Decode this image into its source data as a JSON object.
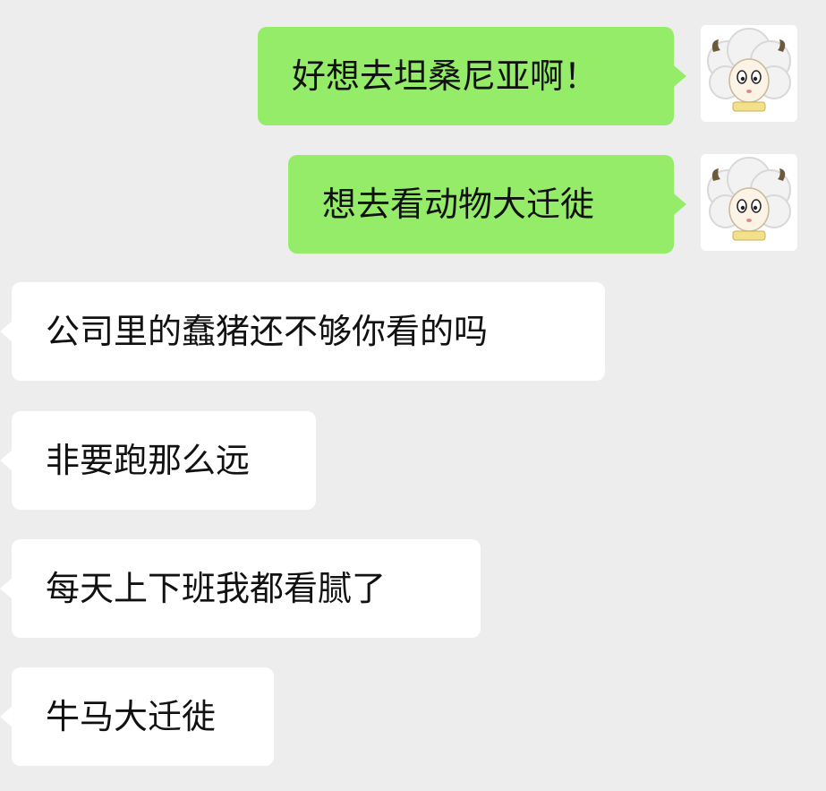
{
  "conversation": {
    "messages": [
      {
        "sender": "me",
        "text": "好想去坦桑尼亚啊！"
      },
      {
        "sender": "me",
        "text": "想去看动物大迁徙"
      },
      {
        "sender": "other",
        "text": "公司里的蠢猪还不够你看的吗"
      },
      {
        "sender": "other",
        "text": "非要跑那么远"
      },
      {
        "sender": "other",
        "text": "每天上下班我都看腻了"
      },
      {
        "sender": "other",
        "text": "牛马大迁徙"
      }
    ]
  },
  "colors": {
    "background": "#ededed",
    "sent_bubble": "#95ec69",
    "received_bubble": "#ffffff",
    "text": "#111111"
  },
  "icons": {
    "avatar": "lamb-avatar-icon"
  }
}
